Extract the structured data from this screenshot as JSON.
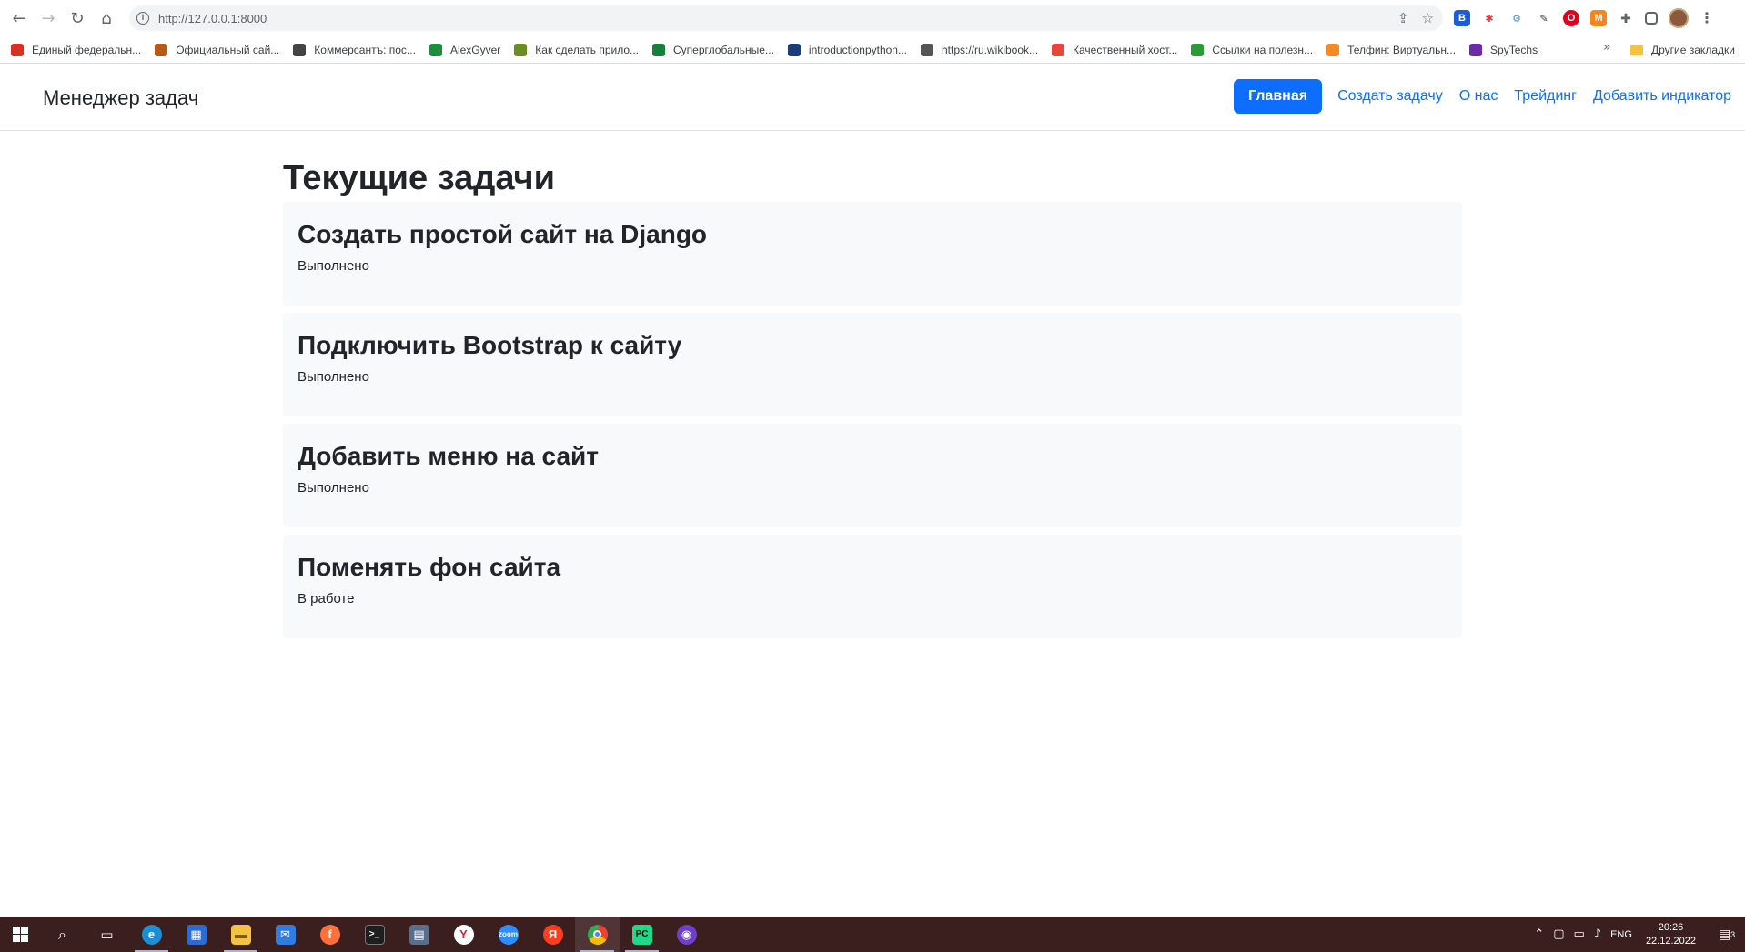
{
  "browser": {
    "url": "http://127.0.0.1:8000",
    "bookmarks": [
      {
        "label": "Единый федеральн...",
        "color": "#d93025"
      },
      {
        "label": "Официальный сай...",
        "color": "#b45a1a"
      },
      {
        "label": "Коммерсантъ: пос...",
        "color": "#444444"
      },
      {
        "label": "AlexGyver",
        "color": "#1e8e3e"
      },
      {
        "label": "Как сделать прило...",
        "color": "#6a8e23"
      },
      {
        "label": "Суперглобальные...",
        "color": "#188038"
      },
      {
        "label": "introductionpython...",
        "color": "#1a3e7a"
      },
      {
        "label": "https://ru.wikibook...",
        "color": "#555555"
      },
      {
        "label": "Качественный хост...",
        "color": "#e8453c"
      },
      {
        "label": "Ссылки на полезн...",
        "color": "#2b9b3a"
      },
      {
        "label": "Телфин: Виртуальн...",
        "color": "#f28b25"
      },
      {
        "label": "SpyTechs",
        "color": "#6a2ca8"
      }
    ],
    "bookmarks_more": "»",
    "other_bookmarks": "Другие закладки"
  },
  "site": {
    "brand": "Менеджер задач",
    "nav": [
      {
        "label": "Главная",
        "active": true
      },
      {
        "label": "Создать задачу",
        "active": false
      },
      {
        "label": "О нас",
        "active": false
      },
      {
        "label": "Трейдинг",
        "active": false
      },
      {
        "label": "Добавить индикатор",
        "active": false
      }
    ],
    "page_title": "Текущие задачи",
    "tasks": [
      {
        "title": "Создать простой сайт на Django",
        "status": "Выполнено"
      },
      {
        "title": "Подключить Bootstrap к сайту",
        "status": "Выполнено"
      },
      {
        "title": "Добавить меню на сайт",
        "status": "Выполнено"
      },
      {
        "title": "Поменять фон сайта",
        "status": "В работе"
      }
    ]
  },
  "taskbar": {
    "lang": "ENG",
    "time": "20:26",
    "date": "22.12.2022",
    "notifications": "3"
  },
  "colors": {
    "accent": "#0d6efd",
    "card_bg": "#f8f9fa",
    "taskbar_bg": "#3b1f1f"
  }
}
